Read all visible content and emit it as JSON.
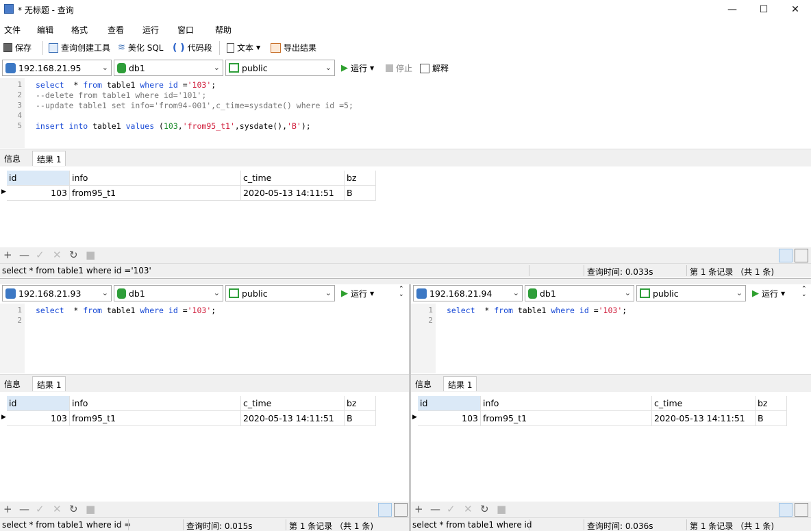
{
  "window": {
    "title": "* 无标题 - 查询",
    "minimize": "—",
    "maximize": "☐",
    "close": "✕"
  },
  "menu": [
    "文件",
    "编辑",
    "格式",
    "查看",
    "运行",
    "窗口",
    "帮助"
  ],
  "toolbar": {
    "save": "保存",
    "query_builder": "查询创建工具",
    "beautify": "美化 SQL",
    "snippet": "代码段",
    "text": "文本",
    "export": "导出结果"
  },
  "panes": [
    {
      "host": "192.168.21.95",
      "db": "db1",
      "schema": "public",
      "run": "运行",
      "stop": "停止",
      "explain": "解释",
      "lines": [
        "1",
        "2",
        "3",
        "4",
        "5"
      ],
      "code": [
        [
          [
            "kw",
            "select"
          ],
          [
            "",
            "  * "
          ],
          [
            "kw",
            "from"
          ],
          [
            "",
            " table1 "
          ],
          [
            "kw",
            "where"
          ],
          [
            "",
            " "
          ],
          [
            "kw",
            "id"
          ],
          [
            "",
            " ="
          ],
          [
            "st",
            "'103'"
          ],
          [
            "",
            ";"
          ]
        ],
        [
          [
            "cm",
            "--delete from table1 where id='101';"
          ]
        ],
        [
          [
            "cm",
            "--update table1 set info='from94-001',c_time=sysdate() where id =5;"
          ]
        ],
        [],
        [
          [
            "kw",
            "insert"
          ],
          [
            "",
            " "
          ],
          [
            "kw",
            "into"
          ],
          [
            "",
            " table1 "
          ],
          [
            "kw",
            "values"
          ],
          [
            "",
            " ("
          ],
          [
            "nm",
            "103"
          ],
          [
            "",
            ","
          ],
          [
            "st",
            "'from95_t1'"
          ],
          [
            "",
            ",sysdate(),"
          ],
          [
            "st",
            "'B'"
          ],
          [
            "",
            ");"
          ]
        ]
      ],
      "tab_info": "信息",
      "tab_result": "结果 1",
      "columns": [
        "id",
        "info",
        "c_time",
        "bz"
      ],
      "rows": [
        [
          "103",
          "from95_t1",
          "2020-05-13 14:11:51",
          "B"
        ]
      ],
      "status_sql": "select * from table1 where id ='103'",
      "status_time": "查询时间: 0.033s",
      "status_records": "第 1 条记录 （共 1 条)"
    },
    {
      "host": "192.168.21.93",
      "db": "db1",
      "schema": "public",
      "run": "运行",
      "lines": [
        "1",
        "2"
      ],
      "code": [
        [
          [
            "kw",
            "select"
          ],
          [
            "",
            "  * "
          ],
          [
            "kw",
            "from"
          ],
          [
            "",
            " table1 "
          ],
          [
            "kw",
            "where"
          ],
          [
            "",
            " "
          ],
          [
            "kw",
            "id"
          ],
          [
            "",
            " ="
          ],
          [
            "st",
            "'103'"
          ],
          [
            "",
            ";"
          ]
        ],
        []
      ],
      "tab_info": "信息",
      "tab_result": "结果 1",
      "columns": [
        "id",
        "info",
        "c_time",
        "bz"
      ],
      "rows": [
        [
          "103",
          "from95_t1",
          "2020-05-13 14:11:51",
          "B"
        ]
      ],
      "status_sql": "select * from table1 where id =",
      "status_time": "查询时间: 0.015s",
      "status_records": "第 1 条记录 （共 1 条)"
    },
    {
      "host": "192.168.21.94",
      "db": "db1",
      "schema": "public",
      "run": "运行",
      "lines": [
        "1",
        "2"
      ],
      "code": [
        [
          [
            "kw",
            "select"
          ],
          [
            "",
            "  * "
          ],
          [
            "kw",
            "from"
          ],
          [
            "",
            " table1 "
          ],
          [
            "kw",
            "where"
          ],
          [
            "",
            " "
          ],
          [
            "kw",
            "id"
          ],
          [
            "",
            " ="
          ],
          [
            "st",
            "'103'"
          ],
          [
            "",
            ";"
          ]
        ],
        []
      ],
      "tab_info": "信息",
      "tab_result": "结果 1",
      "columns": [
        "id",
        "info",
        "c_time",
        "bz"
      ],
      "rows": [
        [
          "103",
          "from95_t1",
          "2020-05-13 14:11:51",
          "B"
        ]
      ],
      "status_sql": "select * from table1 where id",
      "status_time": "查询时间: 0.036s",
      "status_records": "第 1 条记录 （共 1 条)"
    }
  ]
}
